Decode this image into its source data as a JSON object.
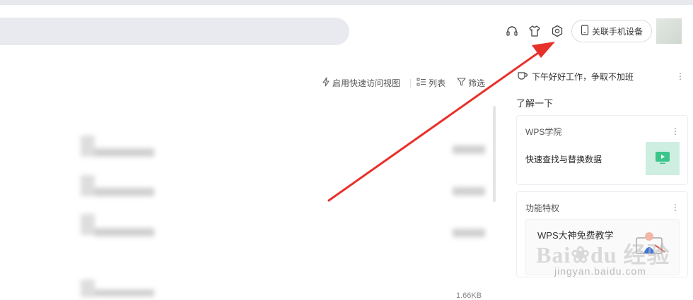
{
  "header": {
    "device_button_label": "关联手机设备",
    "icons": [
      "headset-icon",
      "skin-shirt-icon",
      "settings-gear-icon",
      "phone-icon"
    ]
  },
  "toolbar": {
    "quick_view_label": "启用快速访问视图",
    "list_label": "列表",
    "filter_label": "筛选"
  },
  "file_list": {
    "partial_size": "1.66KB"
  },
  "right_panel": {
    "greeting": "下午好好工作，争取不加班",
    "section_title": "了解一下",
    "cards": [
      {
        "title": "WPS学院",
        "text": "快速查找与替换数据"
      },
      {
        "title": "功能特权",
        "inner_title": "WPS大神免费教学"
      }
    ]
  },
  "watermark": {
    "brand": "Baidu经验",
    "domain": "jingyan.baidu.com"
  },
  "colors": {
    "arrow": "#e8302a",
    "search_bg": "#e8eaef",
    "thumb_bg": "#cfeee2",
    "thumb_icon": "#3cc58a"
  }
}
